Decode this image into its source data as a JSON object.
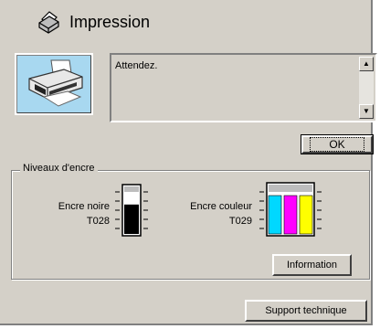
{
  "window": {
    "title": "Impression"
  },
  "status": {
    "message": "Attendez."
  },
  "buttons": {
    "ok_label": "OK",
    "information_label": "Information",
    "support_label": "Support technique"
  },
  "ink_levels": {
    "group_label": "Niveaux d'encre",
    "black": {
      "name": "Encre noire",
      "code": "T028",
      "level": 0.7
    },
    "color": {
      "name": "Encre couleur",
      "code": "T029",
      "level_cyan": 0.75,
      "level_magenta": 0.75,
      "level_yellow": 0.75
    }
  },
  "colors": {
    "window_bg": "#d4d0c8",
    "cyan": "#00d8ff",
    "magenta": "#ff00ff",
    "yellow": "#ffff00",
    "black_ink": "#000000",
    "printer_bg": "#a8d8f0"
  },
  "icons": [
    "printer-icon",
    "scroll-up-icon",
    "scroll-down-icon",
    "black-ink-cartridge-icon",
    "color-ink-cartridge-icon"
  ]
}
